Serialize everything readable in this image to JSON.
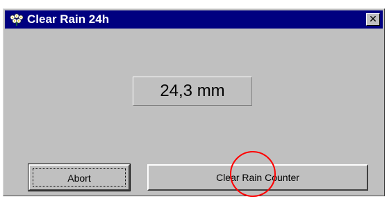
{
  "window": {
    "title": "Clear Rain 24h",
    "app_icon": "flower-cluster-icon",
    "close_glyph": "✕",
    "close_icon": "close-icon"
  },
  "reading": {
    "value_text": "24,3 mm"
  },
  "buttons": {
    "abort_label": "Abort",
    "clear_label": "Clear Rain Counter"
  },
  "overlay": {
    "highlight": "red-circle-highlight",
    "color": "#ff0000"
  },
  "colors": {
    "titlebar": "#000080",
    "face": "#c0c0c0"
  }
}
